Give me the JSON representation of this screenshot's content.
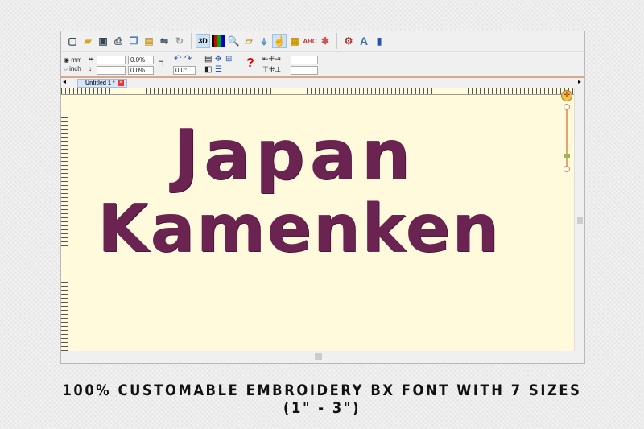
{
  "toolbar": {
    "icons": [
      "new-icon",
      "open-icon",
      "save-icon",
      "print-icon",
      "copy-icon",
      "paste-icon",
      "mirror-icon",
      "rotate-icon",
      "3d-view-icon",
      "color-chart-icon",
      "zoom-icon",
      "ruler-icon",
      "stitch-icon",
      "select-icon",
      "frame-icon",
      "lettering-icon",
      "pattern-icon",
      "settings-icon",
      "text-icon",
      "export-icon"
    ],
    "label_3d": "3D",
    "label_a": "A"
  },
  "props": {
    "unit_mm": "mm",
    "unit_inch": "inch",
    "width_value": "",
    "height_value": "",
    "width_pct": "0.0%",
    "height_pct": "0.0%",
    "angle": "0.0°"
  },
  "tabs": [
    {
      "label": "Untitled 1 *"
    }
  ],
  "design": {
    "line1": "Japan",
    "line2": "Kamenken",
    "thread_color": "#6b2452"
  },
  "caption": "100% CUSTOMABLE EMBROIDERY BX FONT WITH 7 SIZES (1\" -  3\")"
}
